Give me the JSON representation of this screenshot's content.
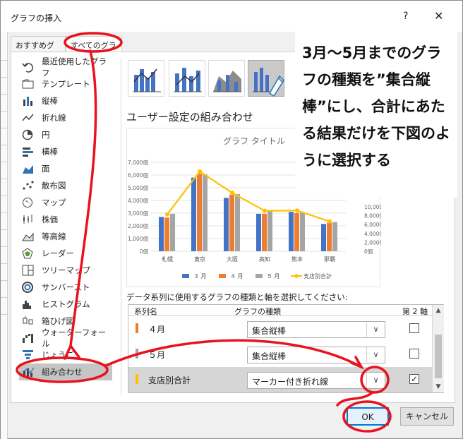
{
  "window": {
    "title": "グラフの挿入",
    "help": "?",
    "close": "✕"
  },
  "tabs": [
    {
      "label": "おすすめグラフ"
    },
    {
      "label": "すべてのグラフ"
    }
  ],
  "sidebar": {
    "items": [
      {
        "label": "最近使用したグラフ",
        "icon": "undo-icon"
      },
      {
        "label": "テンプレート",
        "icon": "folder-icon"
      },
      {
        "label": "縦棒",
        "icon": "column-chart-icon"
      },
      {
        "label": "折れ線",
        "icon": "line-chart-icon"
      },
      {
        "label": "円",
        "icon": "pie-chart-icon"
      },
      {
        "label": "横棒",
        "icon": "bar-chart-icon"
      },
      {
        "label": "面",
        "icon": "area-chart-icon"
      },
      {
        "label": "散布図",
        "icon": "scatter-chart-icon"
      },
      {
        "label": "マップ",
        "icon": "map-icon"
      },
      {
        "label": "株価",
        "icon": "stock-chart-icon"
      },
      {
        "label": "等高線",
        "icon": "surface-chart-icon"
      },
      {
        "label": "レーダー",
        "icon": "radar-chart-icon"
      },
      {
        "label": "ツリーマップ",
        "icon": "treemap-icon"
      },
      {
        "label": "サンバースト",
        "icon": "sunburst-icon"
      },
      {
        "label": "ヒストグラム",
        "icon": "histogram-icon"
      },
      {
        "label": "箱ひげ図",
        "icon": "boxplot-icon"
      },
      {
        "label": "ウォーターフォール",
        "icon": "waterfall-icon"
      },
      {
        "label": "じょうご",
        "icon": "funnel-icon"
      },
      {
        "label": "組み合わせ",
        "icon": "combo-chart-icon"
      }
    ]
  },
  "section_title": "ユーザー設定の組み合わせ",
  "chart_data": {
    "type": "bar",
    "title": "グラフ タイトル",
    "categories": [
      "札幌",
      "東京",
      "大阪",
      "高知",
      "熊本",
      "那覇"
    ],
    "series": [
      {
        "name": "３ 月",
        "values": [
          2700,
          5800,
          4200,
          2950,
          3100,
          2150
        ],
        "color": "#4472c4",
        "kind": "bar"
      },
      {
        "name": "４ 月",
        "values": [
          2650,
          6100,
          4450,
          2950,
          3000,
          2250
        ],
        "color": "#ed7d31",
        "kind": "bar"
      },
      {
        "name": "５ 月",
        "values": [
          2950,
          6050,
          4500,
          3200,
          3050,
          2300
        ],
        "color": "#a5a5a5",
        "kind": "bar"
      },
      {
        "name": "支店別合計",
        "values": [
          8300,
          17950,
          13150,
          9100,
          9150,
          6700
        ],
        "color": "#ffc000",
        "kind": "line",
        "axis": "secondary"
      }
    ],
    "ylim": [
      0,
      7000
    ],
    "yticks": [
      "7,000個",
      "6,000個",
      "5,000個",
      "4,000個",
      "3,000個",
      "2,000個",
      "1,000個",
      "0個"
    ],
    "y2lim": [
      0,
      20000
    ],
    "y2ticks": [
      "10,000個",
      "8,000個",
      "6,000個",
      "4,000個",
      "2,000個",
      "0個"
    ],
    "legend_position": "bottom"
  },
  "series_table": {
    "prompt": "データ系列に使用するグラフの種類と軸を選択してください:",
    "headers": {
      "name": "系列名",
      "type": "グラフの種類",
      "axis": "第 2 軸"
    },
    "rows": [
      {
        "name": "４月",
        "type": "集合縦棒",
        "secondary": false,
        "color": "#ed7d31"
      },
      {
        "name": "５月",
        "type": "集合縦棒",
        "secondary": false,
        "color": "#a5a5a5"
      },
      {
        "name": "支店別合計",
        "type": "マーカー付き折れ線",
        "secondary": true,
        "color": "#ffc000"
      }
    ]
  },
  "buttons": {
    "ok": "OK",
    "cancel": "キャンセル"
  },
  "callout": {
    "text": "3月～5月までのグラフの種類を”集合縦棒”にし、合計にあたる結果だけを下図のように選択する"
  },
  "colors": {
    "annotation": "#e8131d",
    "accent": "#0078d7"
  }
}
